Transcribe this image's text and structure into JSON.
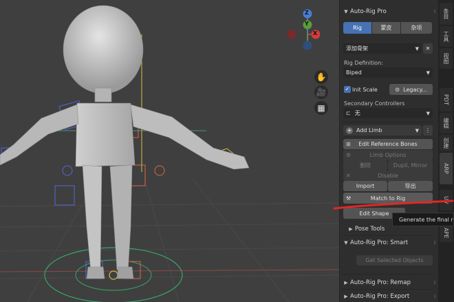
{
  "viewport": {
    "gizmo_axes": {
      "z": "Z",
      "x": "X",
      "y": "Y"
    },
    "nav_icons": [
      "hand-pan-icon",
      "camera-icon",
      "grid-perspective-icon"
    ]
  },
  "panel": {
    "autorig_header": "Auto-Rig Pro",
    "tabs": [
      "Rig",
      "蒙皮",
      "杂项"
    ],
    "add_armature": "添加骨架",
    "rig_definition_label": "Rig Definition:",
    "rig_definition_value": "Biped",
    "init_scale_label": "Init Scale",
    "legacy_button": "Legacy...",
    "secondary_label": "Secondary Controllers",
    "secondary_value": "无",
    "add_limb": "Add Limb",
    "edit_reference_bones": "Edit Reference Bones",
    "limb_options": "Limb Options",
    "delete": "删除",
    "dupli_mirror": "Dupli, Mirror",
    "disable": "Disable",
    "import": "Import",
    "export": "导出",
    "match_to_rig": "Match to Rig",
    "edit_shape": "Edit Shape",
    "pose_tools": "Pose Tools",
    "smart_header": "Auto-Rig Pro: Smart",
    "get_selected_objects": "Get Selected Objects",
    "remap_header": "Auto-Rig Pro: Remap",
    "export_header": "Auto-Rig Pro: Export"
  },
  "sidebar_tabs": [
    "条目",
    "工具",
    "视图",
    "PDT",
    "编辑",
    "创建",
    "ARP",
    "UV",
    "APE"
  ],
  "tooltip": "Generate the final rig"
}
